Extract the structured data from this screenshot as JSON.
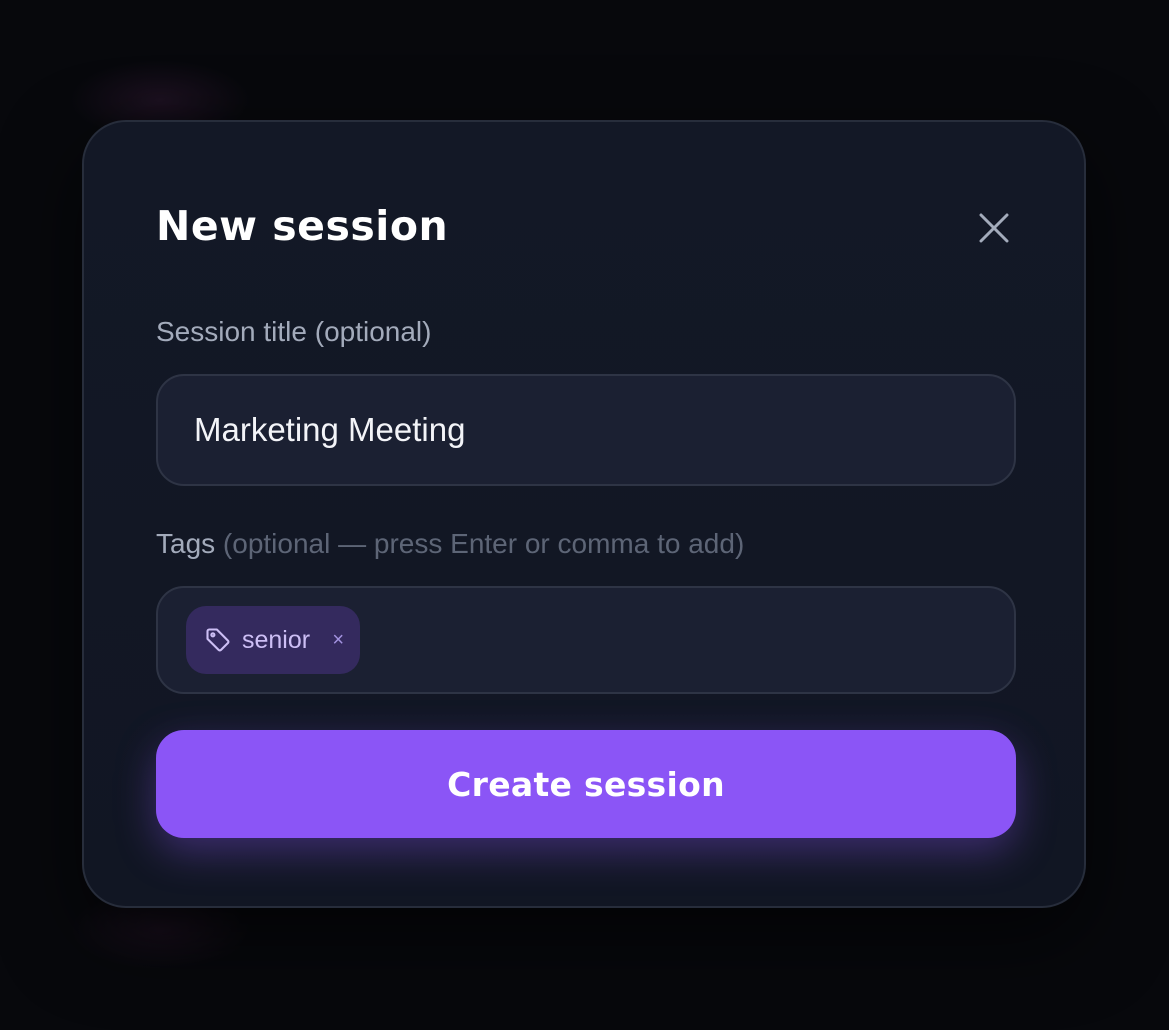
{
  "modal": {
    "title": "New session",
    "close_icon": "close-icon"
  },
  "form": {
    "title_label": "Session title (optional)",
    "title_value": "Marketing Meeting",
    "tags_label": "Tags",
    "tags_hint": " (optional — press Enter or comma to add)",
    "tags": [
      {
        "label": "senior",
        "icon": "tag-icon",
        "remove_label": "×"
      }
    ],
    "submit_label": "Create session"
  },
  "colors": {
    "accent": "#8b55f6",
    "tag_chip_bg": "#342a5e",
    "modal_bg": "#131826",
    "field_bg": "#1b2032"
  }
}
